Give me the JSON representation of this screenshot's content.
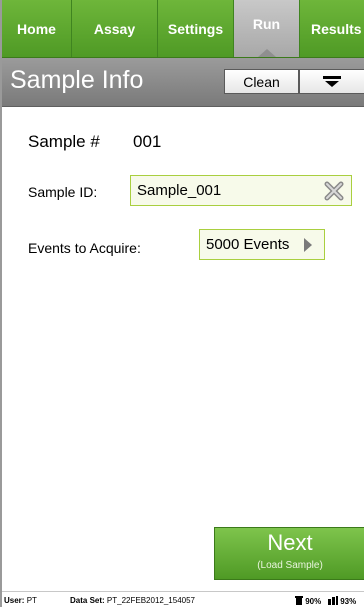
{
  "tabs": [
    {
      "label": "Home",
      "active": false
    },
    {
      "label": "Assay",
      "active": false
    },
    {
      "label": "Settings",
      "active": false
    },
    {
      "label": "Run",
      "active": true
    },
    {
      "label": "Results",
      "active": false
    }
  ],
  "header": {
    "title": "Sample Info",
    "clean_label": "Clean",
    "menu_icon": "menu-icon"
  },
  "sample": {
    "number_label": "Sample #",
    "number_value": "001",
    "id_label": "Sample ID:",
    "id_value": "Sample_001",
    "events_label": "Events to Acquire:",
    "events_value": "5000 Events"
  },
  "next_button": {
    "label": "Next",
    "sublabel": "(Load Sample)"
  },
  "status": {
    "user_label": "User:",
    "user_value": "PT",
    "dataset_label": "Data Set:",
    "dataset_value": "PT_22FEB2012_154057",
    "disk_value": "90%",
    "battery_value": "93%"
  },
  "colors": {
    "accent": "#5aa62e",
    "field_border": "#a9cf3f"
  }
}
